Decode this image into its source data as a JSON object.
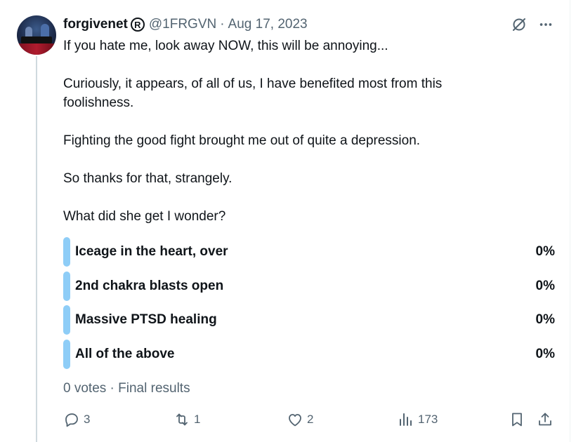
{
  "tweet": {
    "author_name": "forgivenet",
    "author_badge": "R",
    "handle": "@1FRGVN",
    "separator": "·",
    "date": "Aug 17, 2023",
    "paragraphs": [
      "If you hate me, look away NOW, this will be annoying...",
      "Curiously, it appears, of all of us, I have benefited most from this\nfoolishness.",
      "Fighting the good fight brought me out of quite a depression.",
      "So thanks for that, strangely.",
      "What did she get I wonder?"
    ]
  },
  "poll": {
    "options": [
      {
        "label": "Iceage in the heart, over",
        "percent": "0%"
      },
      {
        "label": "2nd chakra blasts open",
        "percent": "0%"
      },
      {
        "label": "Massive PTSD healing",
        "percent": "0%"
      },
      {
        "label": "All of the above",
        "percent": "0%"
      }
    ],
    "bar_color": "#8ecdf7",
    "votes_text": "0 votes",
    "meta_separator": "·",
    "status_text": "Final results"
  },
  "actions": {
    "replies": "3",
    "reposts": "1",
    "likes": "2",
    "views": "173"
  },
  "icons": {
    "grok": "grok-icon",
    "more": "more-icon",
    "reply": "reply-icon",
    "repost": "repost-icon",
    "like": "like-icon",
    "views": "views-icon",
    "bookmark": "bookmark-icon",
    "share": "share-icon"
  },
  "colors": {
    "text": "#0f1419",
    "secondary": "#536471",
    "thread_line": "#cfd9de"
  }
}
